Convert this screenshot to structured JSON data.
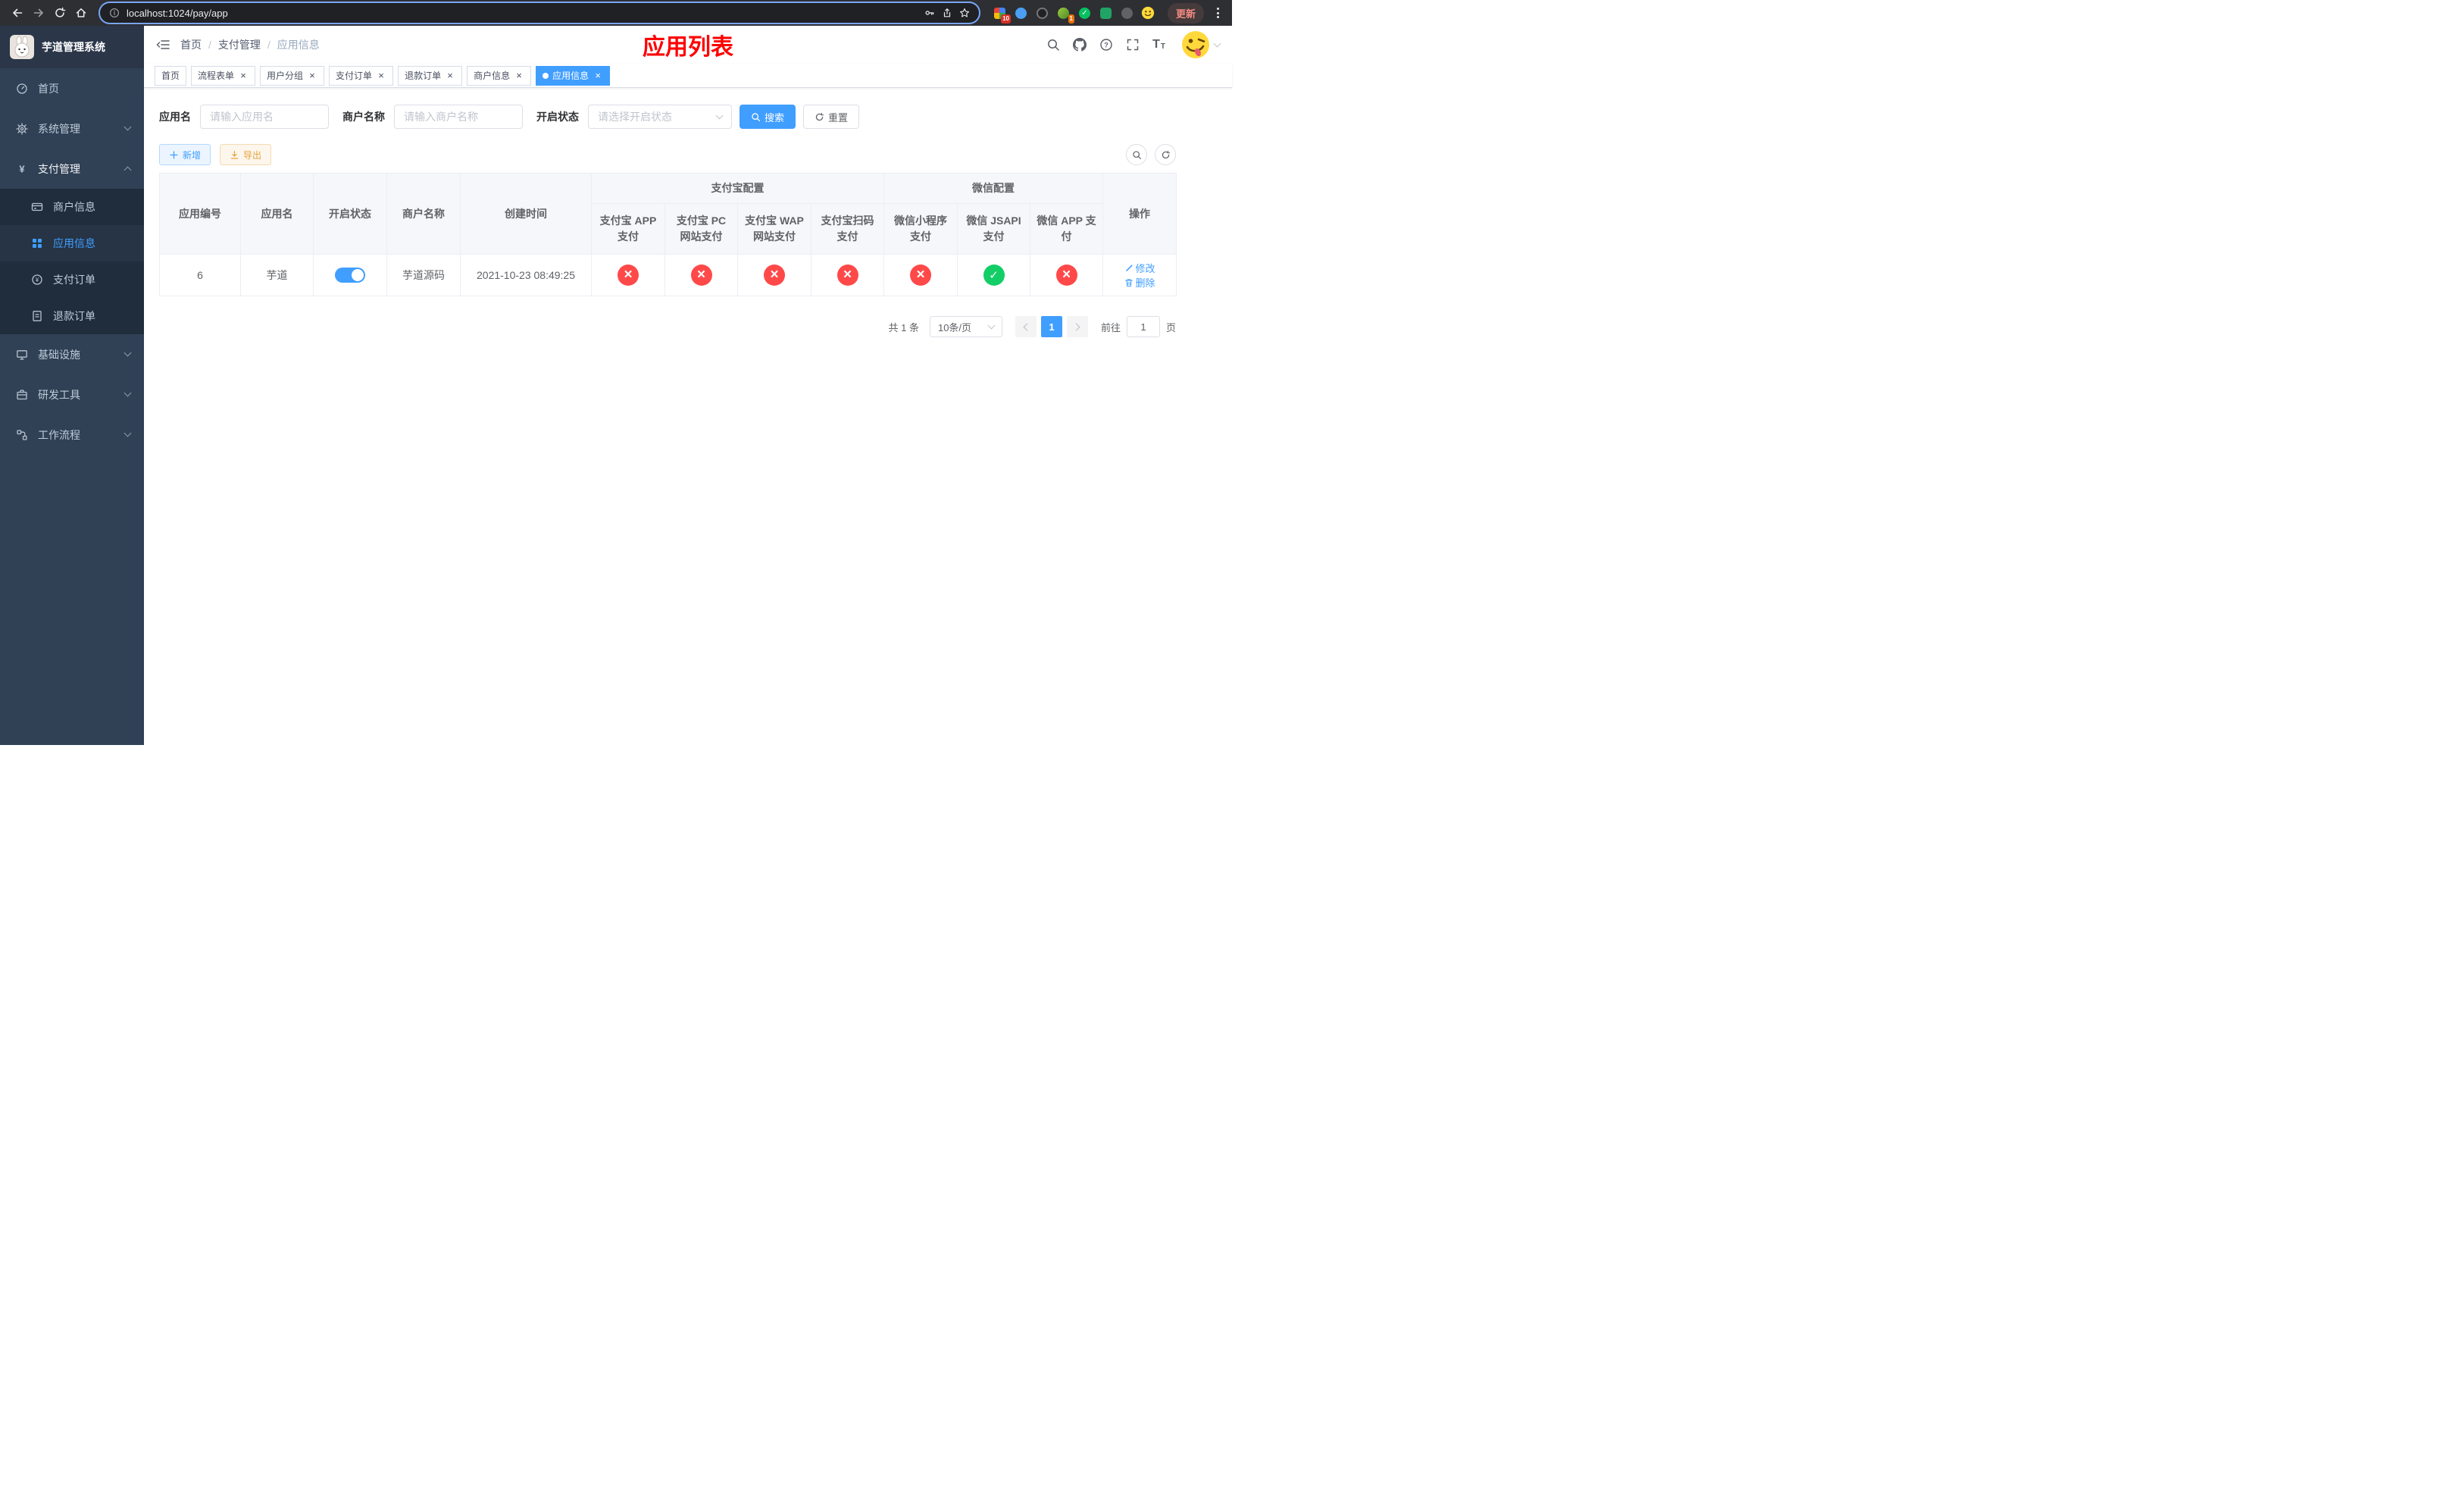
{
  "browser": {
    "url": "localhost:1024/pay/app",
    "update_label": "更新",
    "badge1": "10",
    "badge2": "1"
  },
  "sidebar": {
    "title": "芋道管理系统",
    "menu": [
      {
        "label": "首页"
      },
      {
        "label": "系统管理"
      },
      {
        "label": "支付管理"
      },
      {
        "label": "基础设施"
      },
      {
        "label": "研发工具"
      },
      {
        "label": "工作流程"
      }
    ],
    "submenu": [
      {
        "label": "商户信息"
      },
      {
        "label": "应用信息"
      },
      {
        "label": "支付订单"
      },
      {
        "label": "退款订单"
      }
    ]
  },
  "header": {
    "breadcrumb": [
      "首页",
      "支付管理",
      "应用信息"
    ],
    "separator": "/",
    "title": "应用列表"
  },
  "tabs": [
    {
      "label": "首页"
    },
    {
      "label": "流程表单"
    },
    {
      "label": "用户分组"
    },
    {
      "label": "支付订单"
    },
    {
      "label": "退款订单"
    },
    {
      "label": "商户信息"
    },
    {
      "label": "应用信息"
    }
  ],
  "filter": {
    "app_name_label": "应用名",
    "app_name_placeholder": "请输入应用名",
    "merchant_label": "商户名称",
    "merchant_placeholder": "请输入商户名称",
    "status_label": "开启状态",
    "status_placeholder": "请选择开启状态",
    "search": "搜索",
    "reset": "重置"
  },
  "toolbar": {
    "add": "新增",
    "export": "导出"
  },
  "table": {
    "groups": {
      "alipay": "支付宝配置",
      "wechat": "微信配置"
    },
    "cols": {
      "id": "应用编号",
      "name": "应用名",
      "status": "开启状态",
      "merchant": "商户名称",
      "created": "创建时间",
      "alipay_app": "支付宝 APP 支付",
      "alipay_pc": "支付宝 PC 网站支付",
      "alipay_wap": "支付宝 WAP 网站支付",
      "alipay_qr": "支付宝扫码支付",
      "wx_lite": "微信小程序支付",
      "wx_jsapi": "微信 JSAPI 支付",
      "wx_app": "微信 APP 支付",
      "ops": "操作"
    },
    "row": {
      "id": "6",
      "name": "芋道",
      "enabled": "on",
      "merchant": "芋道源码",
      "created": "2021-10-23 08:49:25",
      "alipay_app": "no",
      "alipay_pc": "no",
      "alipay_wap": "no",
      "alipay_qr": "no",
      "wx_lite": "no",
      "wx_jsapi": "yes",
      "wx_app": "no",
      "edit": "修改",
      "delete": "删除"
    }
  },
  "pagination": {
    "total": "共 1 条",
    "page_size": "10条/页",
    "page": "1",
    "goto": "前往",
    "goto_value": "1",
    "unit": "页"
  },
  "colors": {
    "accent": "#409eff",
    "danger": "#ff4949",
    "success": "#13ce66",
    "title_red": "#ff0000",
    "sidebar_bg": "#304156",
    "submenu_bg": "#1f2d3d"
  }
}
